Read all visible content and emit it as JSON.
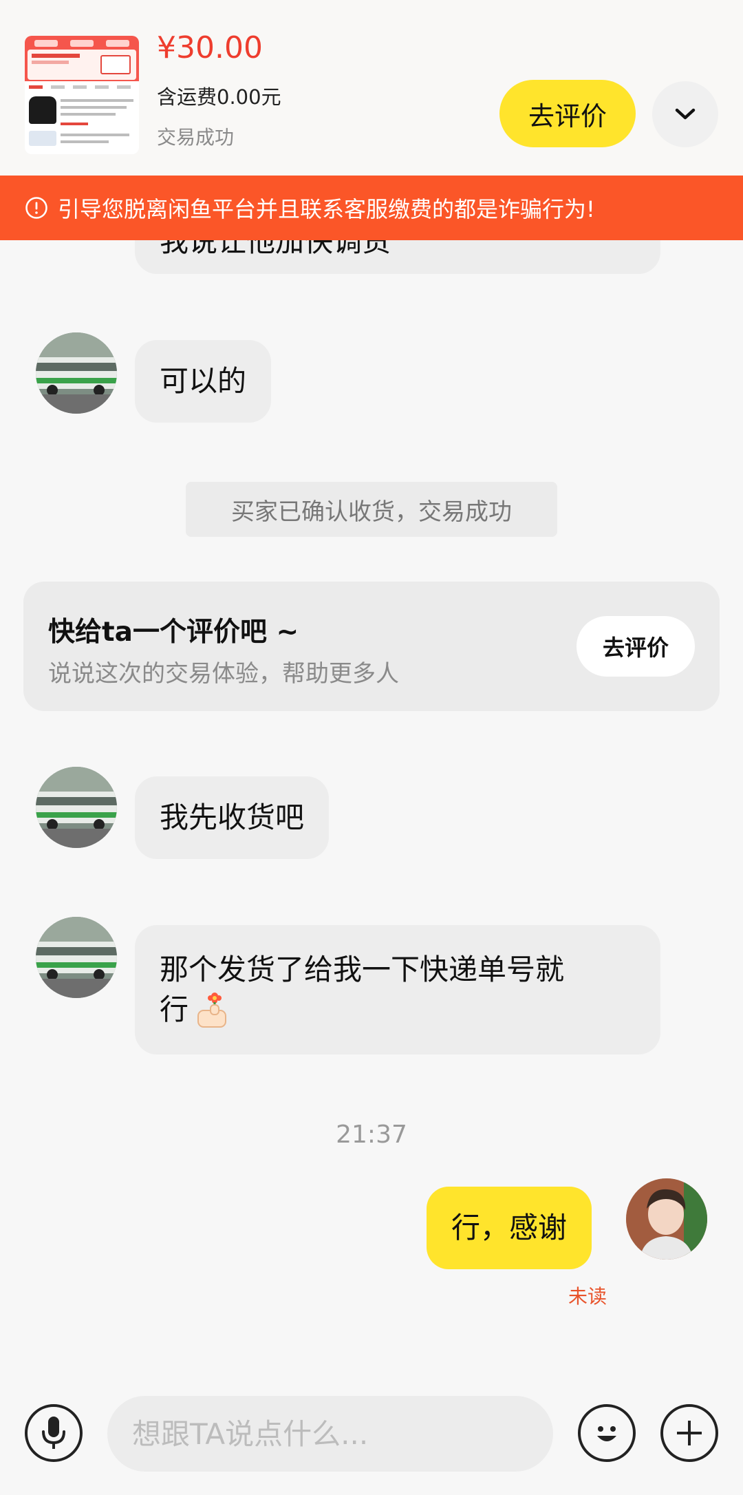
{
  "product": {
    "price": "¥30.00",
    "shipping": "含运费0.00元",
    "status": "交易成功",
    "review_button": "去评价"
  },
  "warning": {
    "text": "引导您脱离闲鱼平台并且联系客服缴费的都是诈骗行为!"
  },
  "messages": [
    {
      "side": "left",
      "text": "我说让他加快调货",
      "partial": true
    },
    {
      "side": "left",
      "text": "可以的"
    },
    {
      "side": "left",
      "text": "我先收货吧"
    },
    {
      "side": "left",
      "text_line1": "那个发货了给我一下快递单号就",
      "text_line2": "行"
    },
    {
      "side": "right",
      "text": "行，感谢",
      "read_status": "未读"
    }
  ],
  "system_notice": "买家已确认收货，交易成功",
  "review_card": {
    "title": "快给ta一个评价吧 ~",
    "subtitle": "说说这次的交易体验，帮助更多人",
    "button": "去评价"
  },
  "timestamp": "21:37",
  "input": {
    "placeholder": "想跟TA说点什么..."
  },
  "colors": {
    "accent_yellow": "#ffe42c",
    "warning_orange": "#fb5628",
    "price_red": "#ee3d2e",
    "unread_orange": "#e8532b"
  },
  "icons": [
    "alert-circle-icon",
    "chevron-down-icon",
    "microphone-icon",
    "emoji-icon",
    "plus-icon"
  ]
}
